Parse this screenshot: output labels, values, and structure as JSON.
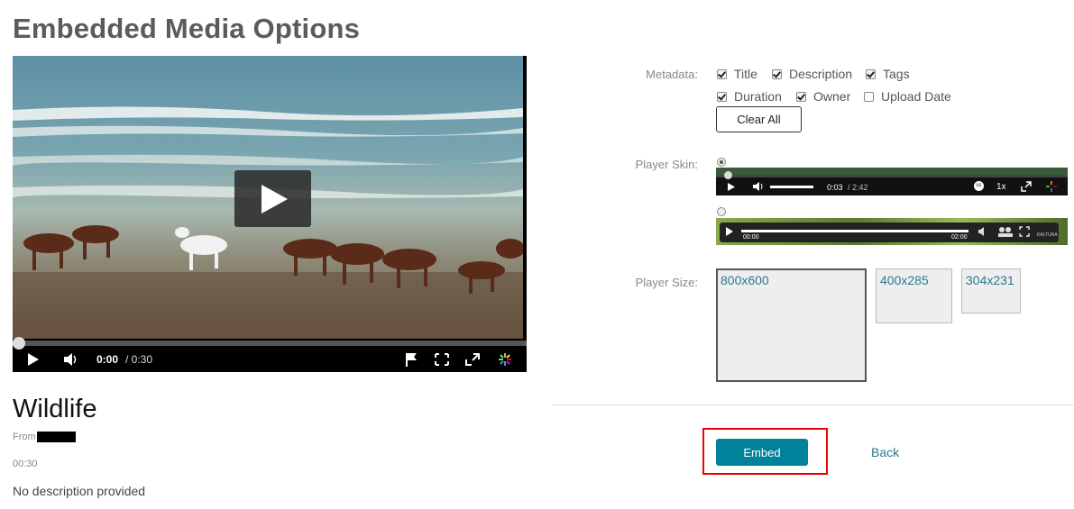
{
  "page": {
    "title": "Embedded Media Options"
  },
  "player": {
    "current_time": "0:00",
    "duration": "/ 0:30",
    "progress": 0
  },
  "media": {
    "title": "Wildlife",
    "from_label": "From",
    "duration": "00:30",
    "description": "No description provided"
  },
  "metadata": {
    "label": "Metadata:",
    "options": [
      {
        "label": "Title",
        "checked": true
      },
      {
        "label": "Description",
        "checked": true
      },
      {
        "label": "Tags",
        "checked": true
      },
      {
        "label": "Duration",
        "checked": true
      },
      {
        "label": "Owner",
        "checked": true
      },
      {
        "label": "Upload Date",
        "checked": false
      }
    ],
    "clear_all": "Clear All"
  },
  "skin": {
    "label": "Player Skin:",
    "skin1": {
      "time": "0:03",
      "duration": "/ 2:42",
      "speed": "1x",
      "selected": true
    },
    "skin2": {
      "time": "00:00",
      "duration": "02:00",
      "brand": "KALTURA",
      "selected": false
    }
  },
  "size": {
    "label": "Player Size:",
    "options": [
      {
        "label": "800x600",
        "selected": true
      },
      {
        "label": "400x285",
        "selected": false
      },
      {
        "label": "304x231",
        "selected": false
      }
    ]
  },
  "actions": {
    "embed": "Embed",
    "back": "Back"
  },
  "colors": {
    "accent": "#00829b",
    "link": "#2a7a8c",
    "highlight": "#e00000"
  }
}
